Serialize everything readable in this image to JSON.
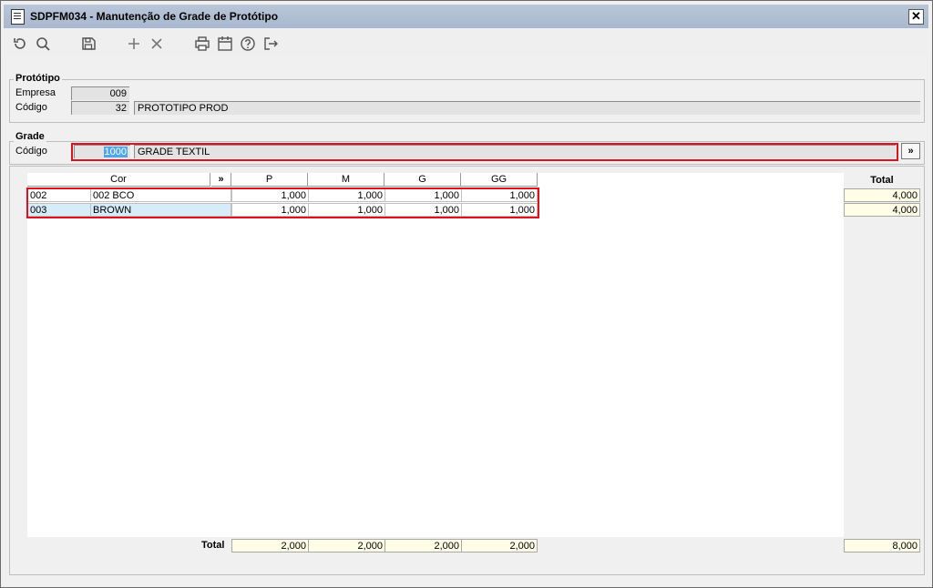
{
  "window": {
    "title": "SDPFM034 - Manutenção de Grade de Protótipo",
    "close_label": "✕"
  },
  "toolbar": {
    "icons": [
      "undo-icon",
      "search-icon",
      "save-icon",
      "add-icon",
      "delete-icon",
      "print-icon",
      "calendar-icon",
      "help-icon",
      "exit-icon"
    ]
  },
  "prototipo": {
    "group_label": "Protótipo",
    "empresa_label": "Empresa",
    "empresa_value": "009",
    "codigo_label": "Código",
    "codigo_value": "32",
    "descricao_value": "PROTOTIPO PROD"
  },
  "grade": {
    "group_label": "Grade",
    "codigo_label": "Código",
    "codigo_value": "1000",
    "descricao_value": "GRADE TEXTIL",
    "expand_label": "»"
  },
  "table": {
    "columns": {
      "cor": "Cor",
      "expand": "»",
      "p": "P",
      "m": "M",
      "g": "G",
      "gg": "GG",
      "total": "Total"
    },
    "rows": [
      {
        "code": "002",
        "name": "002 BCO",
        "p": "1,000",
        "m": "1,000",
        "g": "1,000",
        "gg": "1,000",
        "total": "4,000"
      },
      {
        "code": "003",
        "name": "BROWN",
        "p": "1,000",
        "m": "1,000",
        "g": "1,000",
        "gg": "1,000",
        "total": "4,000"
      }
    ],
    "footer": {
      "label": "Total",
      "p": "2,000",
      "m": "2,000",
      "g": "2,000",
      "gg": "2,000",
      "total": "8,000"
    }
  },
  "colors": {
    "highlight": "#e0101e",
    "selected_row": "#d6ecf8",
    "total_bg": "#fffde6",
    "titlebar": "#b0bfd4"
  }
}
